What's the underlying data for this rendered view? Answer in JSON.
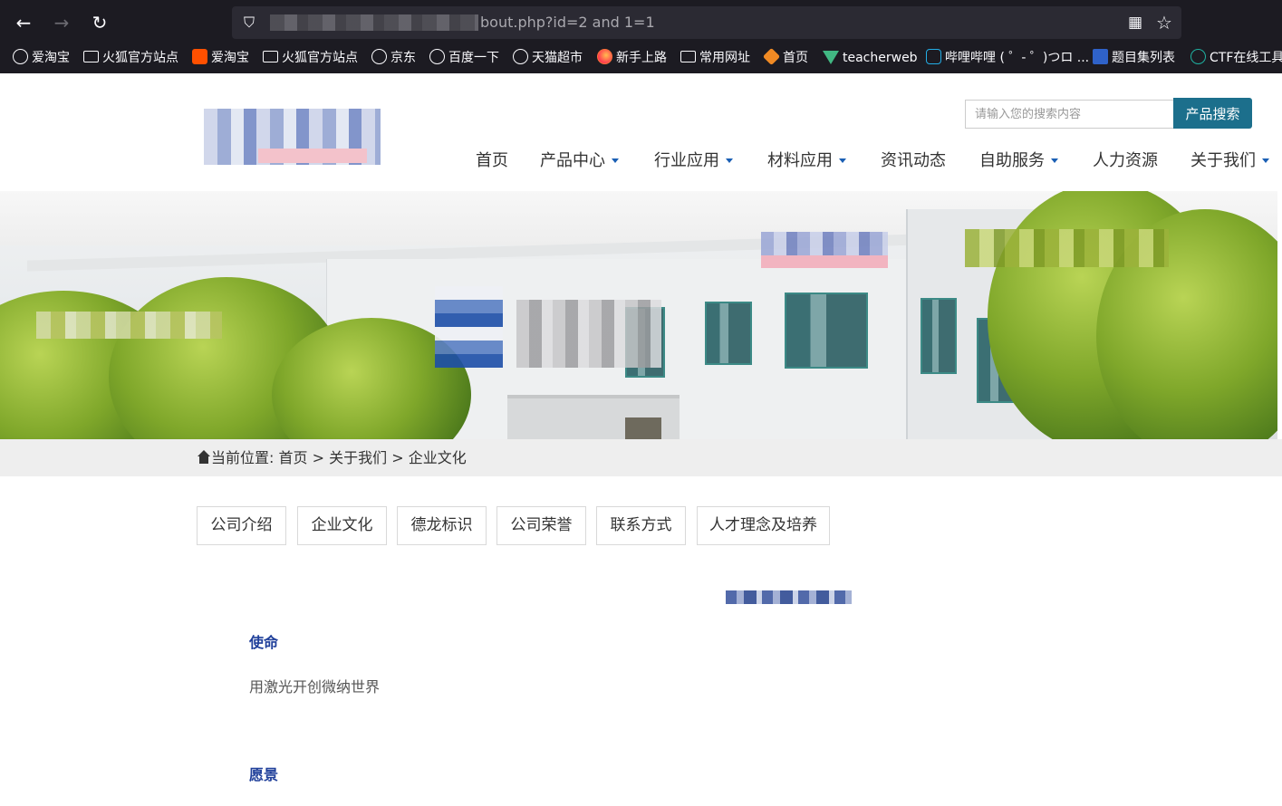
{
  "browser": {
    "url_visible": "bout.php?id=2 and 1=1",
    "icons": {
      "back": "arrow-left-icon",
      "forward": "arrow-right-icon",
      "reload": "reload-icon",
      "shield": "shield-icon",
      "qr": "qr-code-icon",
      "star": "star-icon"
    },
    "bookmarks": [
      {
        "label": "爱淘宝",
        "icon": "globe-icon"
      },
      {
        "label": "火狐官方站点",
        "icon": "folder-icon"
      },
      {
        "label": "爱淘宝",
        "icon": "taobao-icon"
      },
      {
        "label": "火狐官方站点",
        "icon": "folder-icon"
      },
      {
        "label": "京东",
        "icon": "globe-icon"
      },
      {
        "label": "百度一下",
        "icon": "globe-icon"
      },
      {
        "label": "天猫超市",
        "icon": "globe-icon"
      },
      {
        "label": "新手上路",
        "icon": "firefox-icon"
      },
      {
        "label": "常用网址",
        "icon": "folder-icon"
      },
      {
        "label": "首页",
        "icon": "hexagon-icon"
      },
      {
        "label": "teacherweb",
        "icon": "vue-icon"
      },
      {
        "label": "哔哩哔哩 ( ゜- ゜)つロ ...",
        "icon": "bilibili-icon"
      },
      {
        "label": "题目集列表",
        "icon": "document-icon"
      },
      {
        "label": "CTF在线工具",
        "icon": "ctf-icon"
      }
    ]
  },
  "header": {
    "search": {
      "placeholder": "请输入您的搜索内容",
      "button": "产品搜索"
    },
    "nav": [
      {
        "label": "首页",
        "dropdown": false
      },
      {
        "label": "产品中心",
        "dropdown": true
      },
      {
        "label": "行业应用",
        "dropdown": true
      },
      {
        "label": "材料应用",
        "dropdown": true
      },
      {
        "label": "资讯动态",
        "dropdown": false
      },
      {
        "label": "自助服务",
        "dropdown": true
      },
      {
        "label": "人力资源",
        "dropdown": false
      },
      {
        "label": "关于我们",
        "dropdown": true
      }
    ]
  },
  "breadcrumb": {
    "prefix": "当前位置:",
    "items": [
      "首页",
      "关于我们",
      "企业文化"
    ],
    "separator": ">"
  },
  "subtabs": [
    "公司介绍",
    "企业文化",
    "德龙标识",
    "公司荣誉",
    "联系方式",
    "人才理念及培养"
  ],
  "content": {
    "sections": [
      {
        "heading": "使命",
        "text": "用激光开创微纳世界"
      },
      {
        "heading": "愿景",
        "text": ""
      }
    ]
  },
  "colors": {
    "accent": "#1c6f8c",
    "heading": "#1f3f9a",
    "chrome_bg": "#1c1b22",
    "crumb_bg": "#eeeeee",
    "caret": "#1a5fb4"
  }
}
